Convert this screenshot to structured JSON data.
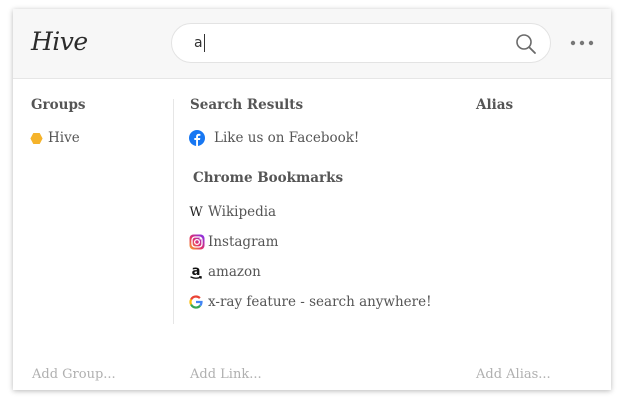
{
  "header": {
    "logo_text": "Hive",
    "search": {
      "value": "a"
    }
  },
  "columns": {
    "groups_title": "Groups",
    "results_title": "Search Results",
    "alias_title": "Alias"
  },
  "groups": [
    {
      "label": "Hive",
      "icon": "hexagon-icon",
      "color": "#f5b32b"
    }
  ],
  "search_results": [
    {
      "label": "Like us on Facebook!",
      "icon": "facebook-icon",
      "color": "#1877f2"
    }
  ],
  "bookmarks": {
    "title": "Chrome Bookmarks",
    "items": [
      {
        "label": "Wikipedia",
        "icon": "wikipedia-icon"
      },
      {
        "label": "Instagram",
        "icon": "instagram-icon"
      },
      {
        "label": "amazon",
        "icon": "amazon-icon"
      },
      {
        "label": "x-ray feature - search anywhere!",
        "icon": "google-icon"
      }
    ]
  },
  "footer": {
    "add_group": "Add Group...",
    "add_link": "Add Link...",
    "add_alias": "Add Alias..."
  }
}
